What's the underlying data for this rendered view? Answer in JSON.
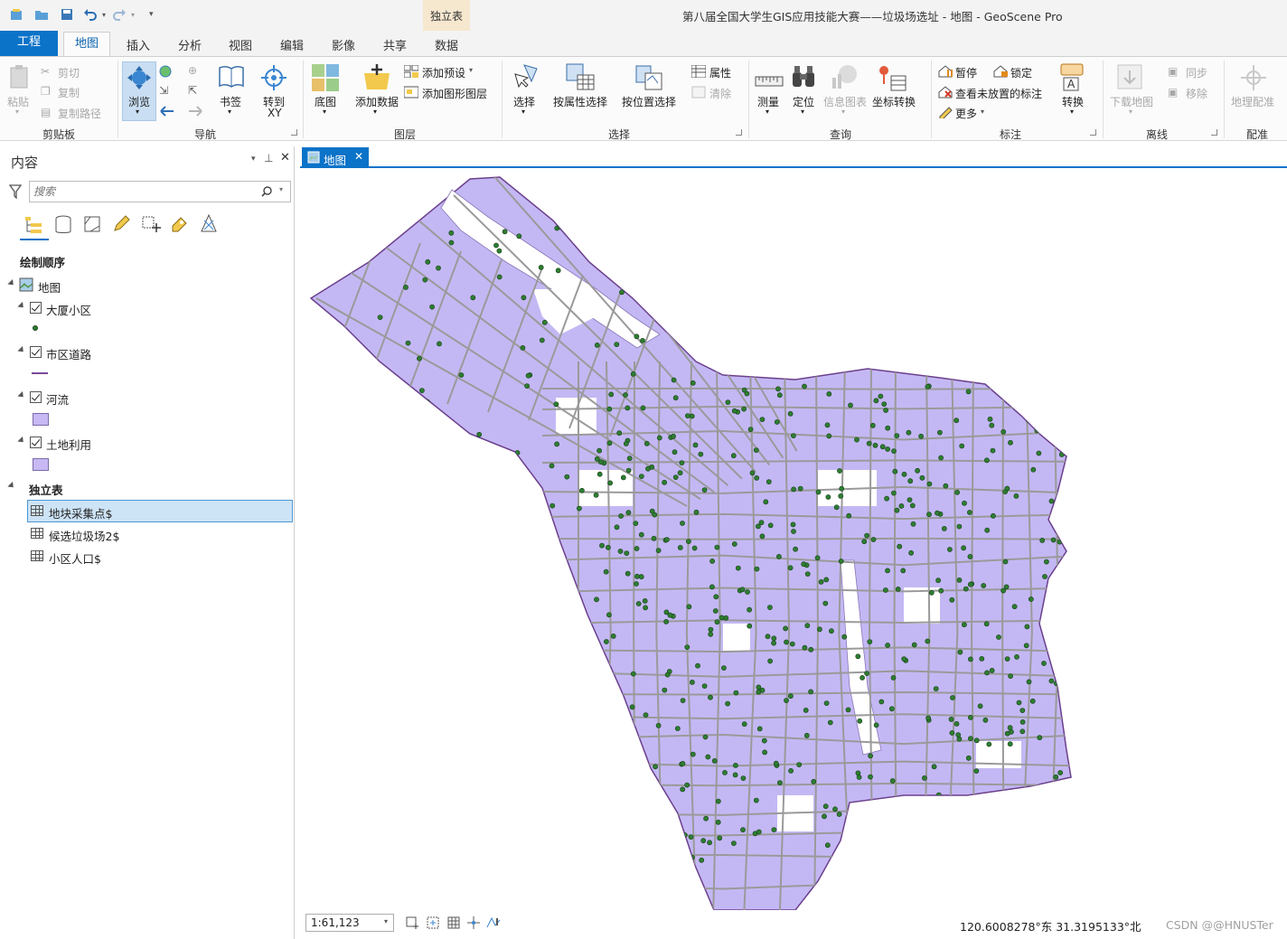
{
  "window": {
    "title": "第八届全国大学生GIS应用技能大赛——垃圾场选址 - 地图 - GeoScene Pro",
    "context_group": "独立表"
  },
  "tabs": {
    "project": "工程",
    "items": [
      "地图",
      "插入",
      "分析",
      "视图",
      "编辑",
      "影像",
      "共享",
      "数据"
    ],
    "active": "地图"
  },
  "ribbon": {
    "clipboard": {
      "paste": "粘贴",
      "cut": "剪切",
      "copy": "复制",
      "copy_path": "复制路径",
      "label": "剪贴板"
    },
    "navigate": {
      "explore": "浏览",
      "bookmarks": "书签",
      "goto_xy_1": "转到",
      "goto_xy_2": "XY",
      "label": "导航"
    },
    "layer": {
      "basemap": "底图",
      "add_data": "添加数据",
      "add_preset": "添加预设",
      "add_graphics": "添加图形图层",
      "label": "图层"
    },
    "selection": {
      "select": "选择",
      "by_attr": "按属性选择",
      "by_location": "按位置选择",
      "attributes": "属性",
      "clear": "清除",
      "label": "选择"
    },
    "inquiry": {
      "measure": "测量",
      "locate": "定位",
      "infographics": "信息图表",
      "convert_coords": "坐标转换",
      "label": "查询"
    },
    "labeling": {
      "pause": "暂停",
      "lock": "锁定",
      "view_unplaced": "查看未放置的标注",
      "more": "更多",
      "convert": "转换",
      "label": "标注"
    },
    "offline": {
      "download_map": "下载地图",
      "sync": "同步",
      "remove": "移除",
      "label": "离线"
    },
    "georef": {
      "georeference": "地理配准",
      "label": "配准"
    }
  },
  "contents": {
    "title": "内容",
    "search_placeholder": "搜索",
    "drawing_order": "绘制顺序",
    "map_name": "地图",
    "layers": [
      {
        "name": "大厦小区",
        "symbol": "point",
        "color": "#2e7d32"
      },
      {
        "name": "市区道路",
        "symbol": "line",
        "color": "#7b4a9a"
      },
      {
        "name": "河流",
        "symbol": "polygon",
        "color": "#c8b9f5"
      },
      {
        "name": "土地利用",
        "symbol": "polygon",
        "color": "#c8b9f5"
      }
    ],
    "standalone_heading": "独立表",
    "tables": [
      "地块采集点$",
      "候选垃圾场2$",
      "小区人口$"
    ],
    "selected_table": "地块采集点$"
  },
  "map_view": {
    "tab_label": "地图",
    "scale": "1:61,123",
    "coordinates": "120.6008278°东 31.3195133°北",
    "watermark": "CSDN @@HNUSTer"
  },
  "colors": {
    "accent": "#0b73c8",
    "land_fill": "#c4b8f4",
    "road_stroke": "#9a9a9a",
    "boundary": "#6b3f8c",
    "point": "#2e7d32"
  }
}
